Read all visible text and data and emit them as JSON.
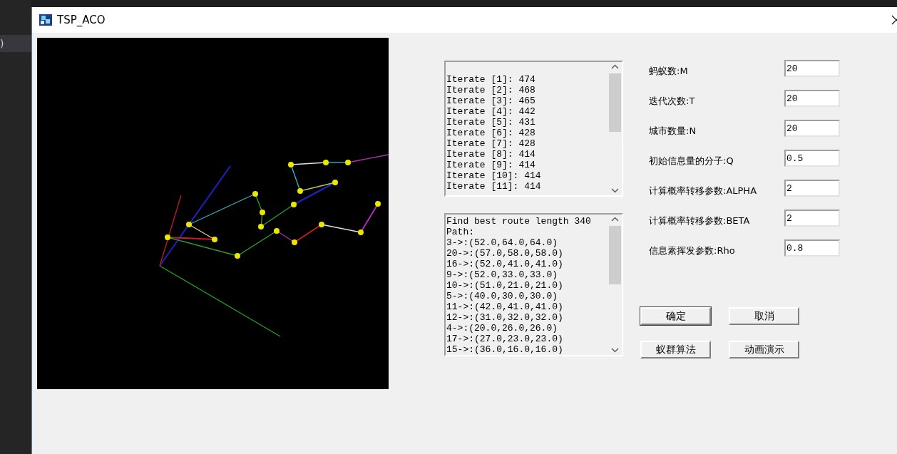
{
  "background": {
    "editor_fragment": ")"
  },
  "window": {
    "title": "TSP_ACO"
  },
  "iteration_log": {
    "lines": [
      "Iterate [1]: 474",
      "Iterate [2]: 468",
      "Iterate [3]: 465",
      "Iterate [4]: 442",
      "Iterate [5]: 431",
      "Iterate [6]: 428",
      "Iterate [7]: 428",
      "Iterate [8]: 414",
      "Iterate [9]: 414",
      "Iterate [10]: 414",
      "Iterate [11]: 414"
    ]
  },
  "result_log": {
    "lines": [
      "Find best route length 340",
      "Path:",
      "3->:(52.0,64.0,64.0)",
      "20->:(57.0,58.0,58.0)",
      "16->:(52.0,41.0,41.0)",
      "9->:(52.0,33.0,33.0)",
      "10->:(51.0,21.0,21.0)",
      "5->:(40.0,30.0,30.0)",
      "11->:(42.0,41.0,41.0)",
      "12->:(31.0,32.0,32.0)",
      "4->:(20.0,26.0,26.0)",
      "17->:(27.0,23.0,23.0)",
      "15->:(36.0,16.0,16.0)"
    ]
  },
  "parameters": [
    {
      "label": "蚂蚁数:M",
      "value": "20"
    },
    {
      "label": "迭代次数:T",
      "value": "20"
    },
    {
      "label": "城市数量:N",
      "value": "20"
    },
    {
      "label": "初始信息量的分子:Q",
      "value": "0.5"
    },
    {
      "label": "计算概率转移参数:ALPHA",
      "value": "2"
    },
    {
      "label": "计算概率转移参数:BETA",
      "value": "2"
    },
    {
      "label": "信息素挥发参数:Rho",
      "value": "0.8"
    }
  ],
  "buttons": [
    {
      "label": "确定",
      "default": true
    },
    {
      "label": "取消",
      "default": false
    },
    {
      "label": "蚁群算法",
      "default": false
    },
    {
      "label": "动画演示",
      "default": false
    }
  ]
}
